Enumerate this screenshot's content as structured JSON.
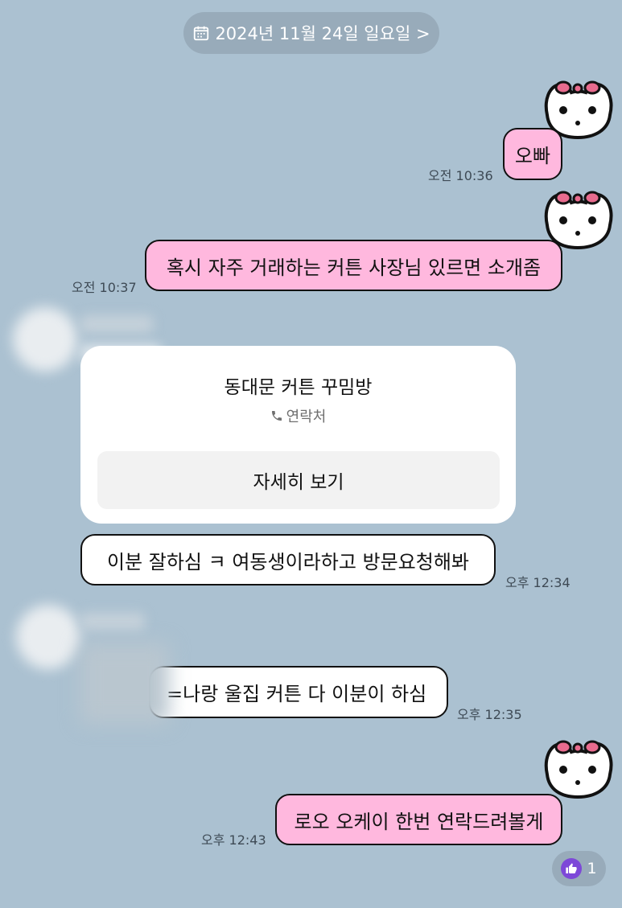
{
  "date_header": {
    "label": "2024년 11월 24일 일요일 >"
  },
  "messages": [
    {
      "text": "오빠",
      "time": "오전 10:36"
    },
    {
      "text": "혹시 자주 거래하는 커튼 사장님 있르면 소개좀",
      "time": "오전 10:37"
    },
    {
      "text": "이분 잘하심 ㅋ 여동생이라하고 방문요청해봐",
      "time": "오후 12:34"
    },
    {
      "text": "=나랑 울집 커튼 다 이분이 하심",
      "time": "오후 12:35"
    },
    {
      "text": "로오 오케이 한번 연락드려볼게",
      "time": "오후 12:43"
    }
  ],
  "contact_card": {
    "title": "동대문 커튼 꾸밈방",
    "subtitle": "연락처",
    "button_label": "자세히 보기"
  },
  "reaction": {
    "count": "1"
  },
  "colors": {
    "background": "#abc1d1",
    "my_bubble": "#ffb8de",
    "other_bubble": "#ffffff",
    "reaction_thumb": "#7d48d8"
  },
  "icons": [
    "calendar-icon",
    "phone-icon",
    "thumbs-up-icon",
    "cat-sticker"
  ]
}
